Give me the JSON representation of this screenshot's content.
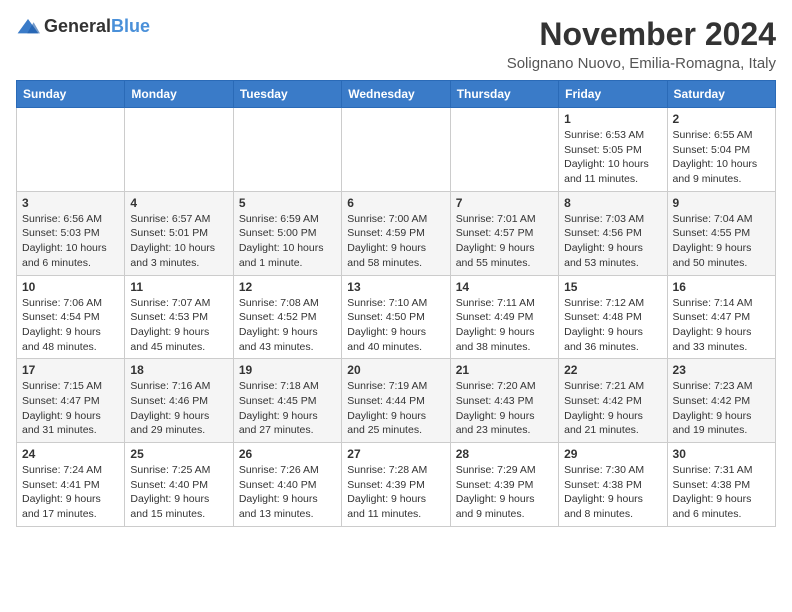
{
  "logo": {
    "general": "General",
    "blue": "Blue"
  },
  "title": "November 2024",
  "subtitle": "Solignano Nuovo, Emilia-Romagna, Italy",
  "weekdays": [
    "Sunday",
    "Monday",
    "Tuesday",
    "Wednesday",
    "Thursday",
    "Friday",
    "Saturday"
  ],
  "weeks": [
    [
      {
        "day": "",
        "info": ""
      },
      {
        "day": "",
        "info": ""
      },
      {
        "day": "",
        "info": ""
      },
      {
        "day": "",
        "info": ""
      },
      {
        "day": "",
        "info": ""
      },
      {
        "day": "1",
        "info": "Sunrise: 6:53 AM\nSunset: 5:05 PM\nDaylight: 10 hours and 11 minutes."
      },
      {
        "day": "2",
        "info": "Sunrise: 6:55 AM\nSunset: 5:04 PM\nDaylight: 10 hours and 9 minutes."
      }
    ],
    [
      {
        "day": "3",
        "info": "Sunrise: 6:56 AM\nSunset: 5:03 PM\nDaylight: 10 hours and 6 minutes."
      },
      {
        "day": "4",
        "info": "Sunrise: 6:57 AM\nSunset: 5:01 PM\nDaylight: 10 hours and 3 minutes."
      },
      {
        "day": "5",
        "info": "Sunrise: 6:59 AM\nSunset: 5:00 PM\nDaylight: 10 hours and 1 minute."
      },
      {
        "day": "6",
        "info": "Sunrise: 7:00 AM\nSunset: 4:59 PM\nDaylight: 9 hours and 58 minutes."
      },
      {
        "day": "7",
        "info": "Sunrise: 7:01 AM\nSunset: 4:57 PM\nDaylight: 9 hours and 55 minutes."
      },
      {
        "day": "8",
        "info": "Sunrise: 7:03 AM\nSunset: 4:56 PM\nDaylight: 9 hours and 53 minutes."
      },
      {
        "day": "9",
        "info": "Sunrise: 7:04 AM\nSunset: 4:55 PM\nDaylight: 9 hours and 50 minutes."
      }
    ],
    [
      {
        "day": "10",
        "info": "Sunrise: 7:06 AM\nSunset: 4:54 PM\nDaylight: 9 hours and 48 minutes."
      },
      {
        "day": "11",
        "info": "Sunrise: 7:07 AM\nSunset: 4:53 PM\nDaylight: 9 hours and 45 minutes."
      },
      {
        "day": "12",
        "info": "Sunrise: 7:08 AM\nSunset: 4:52 PM\nDaylight: 9 hours and 43 minutes."
      },
      {
        "day": "13",
        "info": "Sunrise: 7:10 AM\nSunset: 4:50 PM\nDaylight: 9 hours and 40 minutes."
      },
      {
        "day": "14",
        "info": "Sunrise: 7:11 AM\nSunset: 4:49 PM\nDaylight: 9 hours and 38 minutes."
      },
      {
        "day": "15",
        "info": "Sunrise: 7:12 AM\nSunset: 4:48 PM\nDaylight: 9 hours and 36 minutes."
      },
      {
        "day": "16",
        "info": "Sunrise: 7:14 AM\nSunset: 4:47 PM\nDaylight: 9 hours and 33 minutes."
      }
    ],
    [
      {
        "day": "17",
        "info": "Sunrise: 7:15 AM\nSunset: 4:47 PM\nDaylight: 9 hours and 31 minutes."
      },
      {
        "day": "18",
        "info": "Sunrise: 7:16 AM\nSunset: 4:46 PM\nDaylight: 9 hours and 29 minutes."
      },
      {
        "day": "19",
        "info": "Sunrise: 7:18 AM\nSunset: 4:45 PM\nDaylight: 9 hours and 27 minutes."
      },
      {
        "day": "20",
        "info": "Sunrise: 7:19 AM\nSunset: 4:44 PM\nDaylight: 9 hours and 25 minutes."
      },
      {
        "day": "21",
        "info": "Sunrise: 7:20 AM\nSunset: 4:43 PM\nDaylight: 9 hours and 23 minutes."
      },
      {
        "day": "22",
        "info": "Sunrise: 7:21 AM\nSunset: 4:42 PM\nDaylight: 9 hours and 21 minutes."
      },
      {
        "day": "23",
        "info": "Sunrise: 7:23 AM\nSunset: 4:42 PM\nDaylight: 9 hours and 19 minutes."
      }
    ],
    [
      {
        "day": "24",
        "info": "Sunrise: 7:24 AM\nSunset: 4:41 PM\nDaylight: 9 hours and 17 minutes."
      },
      {
        "day": "25",
        "info": "Sunrise: 7:25 AM\nSunset: 4:40 PM\nDaylight: 9 hours and 15 minutes."
      },
      {
        "day": "26",
        "info": "Sunrise: 7:26 AM\nSunset: 4:40 PM\nDaylight: 9 hours and 13 minutes."
      },
      {
        "day": "27",
        "info": "Sunrise: 7:28 AM\nSunset: 4:39 PM\nDaylight: 9 hours and 11 minutes."
      },
      {
        "day": "28",
        "info": "Sunrise: 7:29 AM\nSunset: 4:39 PM\nDaylight: 9 hours and 9 minutes."
      },
      {
        "day": "29",
        "info": "Sunrise: 7:30 AM\nSunset: 4:38 PM\nDaylight: 9 hours and 8 minutes."
      },
      {
        "day": "30",
        "info": "Sunrise: 7:31 AM\nSunset: 4:38 PM\nDaylight: 9 hours and 6 minutes."
      }
    ]
  ]
}
